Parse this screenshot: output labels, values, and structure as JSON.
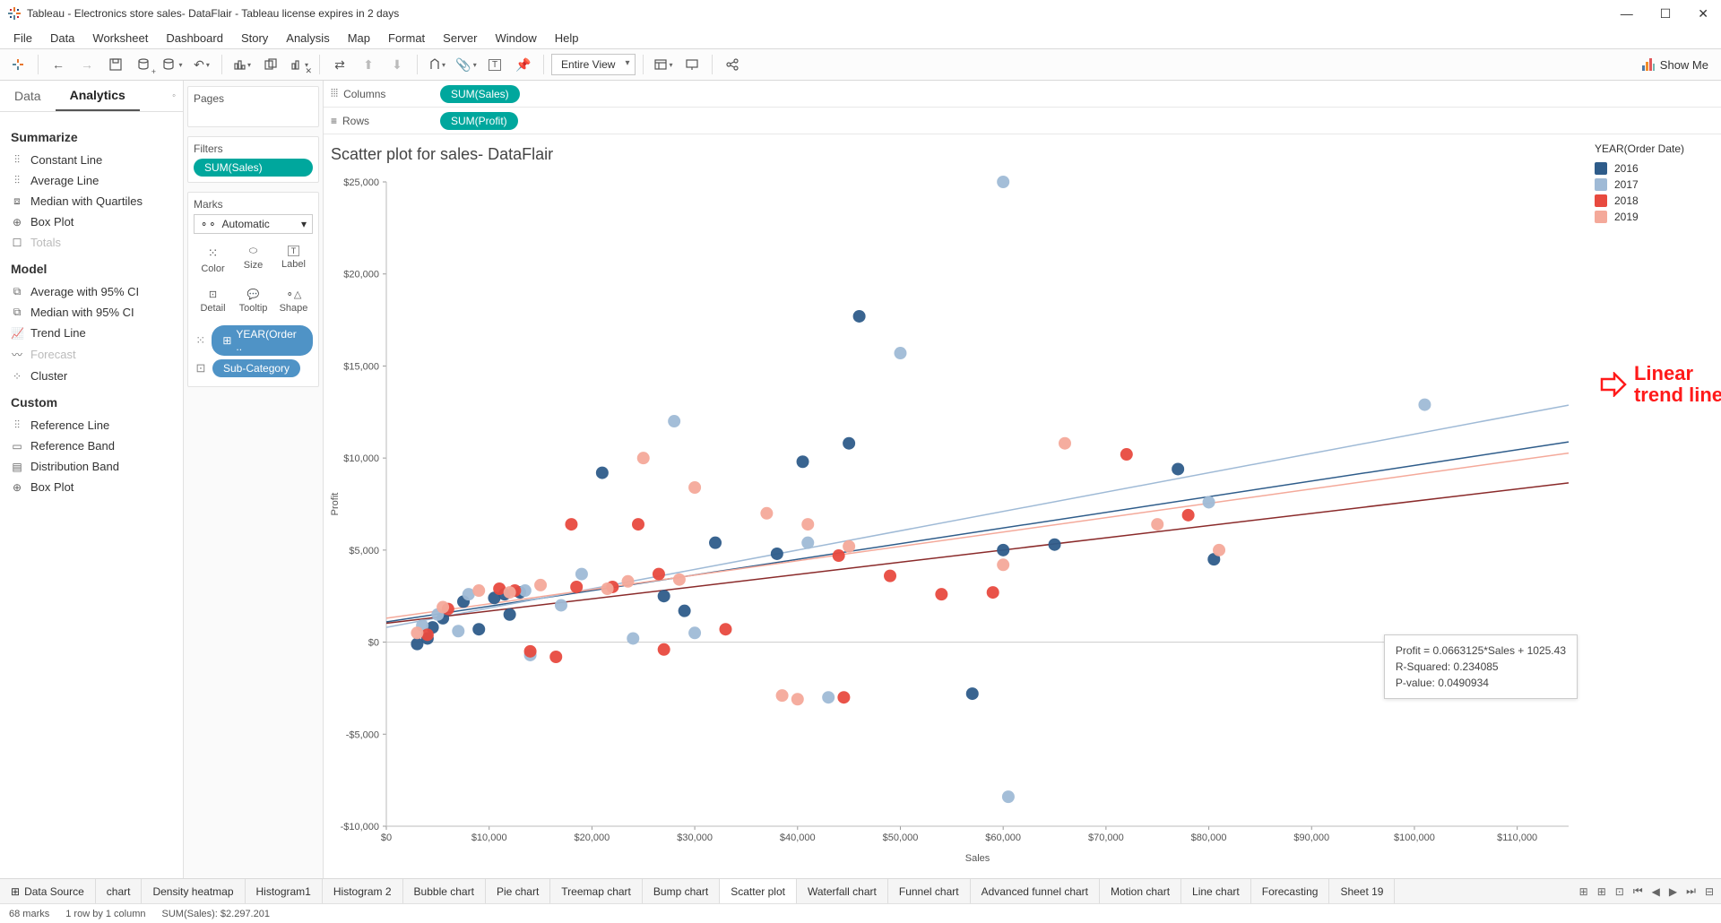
{
  "window": {
    "title": "Tableau - Electronics store sales- DataFlair - Tableau license expires in 2 days"
  },
  "menu": [
    "File",
    "Data",
    "Worksheet",
    "Dashboard",
    "Story",
    "Analysis",
    "Map",
    "Format",
    "Server",
    "Window",
    "Help"
  ],
  "toolbar": {
    "fit": "Entire View",
    "showme": "Show Me"
  },
  "sidepane": {
    "tabs": {
      "data": "Data",
      "analytics": "Analytics"
    },
    "summarize": {
      "head": "Summarize",
      "items": [
        "Constant Line",
        "Average Line",
        "Median with Quartiles",
        "Box Plot",
        "Totals"
      ]
    },
    "model": {
      "head": "Model",
      "items": [
        "Average with 95% CI",
        "Median with 95% CI",
        "Trend Line",
        "Forecast",
        "Cluster"
      ]
    },
    "custom": {
      "head": "Custom",
      "items": [
        "Reference Line",
        "Reference Band",
        "Distribution Band",
        "Box Plot"
      ]
    }
  },
  "shelves": {
    "pages": "Pages",
    "filters": "Filters",
    "filter_pill": "SUM(Sales)",
    "marks": "Marks",
    "marks_type": "Automatic",
    "mark_cells": [
      "Color",
      "Size",
      "Label",
      "Detail",
      "Tooltip",
      "Shape"
    ],
    "mark_pill1": "YEAR(Order ..",
    "mark_pill2": "Sub-Category",
    "columns_label": "Columns",
    "rows_label": "Rows",
    "col_pill": "SUM(Sales)",
    "row_pill": "SUM(Profit)"
  },
  "chart": {
    "title": "Scatter plot for sales- DataFlair",
    "xlabel": "Sales",
    "ylabel": "Profit",
    "legend_title": "YEAR(Order Date)"
  },
  "legend": [
    {
      "label": "2016",
      "color": "#2e5c8a"
    },
    {
      "label": "2017",
      "color": "#9fbad6"
    },
    {
      "label": "2018",
      "color": "#e84a3f"
    },
    {
      "label": "2019",
      "color": "#f4a99a"
    }
  ],
  "tooltip": {
    "l1": "Profit = 0.0663125*Sales + 1025.43",
    "l2": "R-Squared: 0.234085",
    "l3": "P-value: 0.0490934"
  },
  "annotation": "Linear\ntrend line",
  "sheets": {
    "ds": "Data Source",
    "tabs": [
      "chart",
      "Density heatmap",
      "Histogram1",
      "Histogram 2",
      "Bubble chart",
      "Pie chart",
      "Treemap chart",
      "Bump chart",
      "Scatter plot",
      "Waterfall chart",
      "Funnel chart",
      "Advanced funnel chart",
      "Motion chart",
      "Line chart",
      "Forecasting",
      "Sheet 19"
    ],
    "active": "Scatter plot"
  },
  "status": {
    "marks": "68 marks",
    "layout": "1 row by 1 column",
    "sum": "SUM(Sales): $2.297.201"
  },
  "chart_data": {
    "type": "scatter",
    "xlabel": "Sales",
    "ylabel": "Profit",
    "xlim": [
      0,
      115000
    ],
    "ylim": [
      -10000,
      25000
    ],
    "xticks": [
      0,
      10000,
      20000,
      30000,
      40000,
      50000,
      60000,
      70000,
      80000,
      90000,
      100000,
      110000
    ],
    "yticks": [
      -10000,
      -5000,
      0,
      5000,
      10000,
      15000,
      20000,
      25000
    ],
    "series": [
      {
        "name": "2016",
        "color": "#2e5c8a",
        "points": [
          [
            3000,
            -100
          ],
          [
            4000,
            200
          ],
          [
            4500,
            800
          ],
          [
            5500,
            1300
          ],
          [
            7500,
            2200
          ],
          [
            9000,
            700
          ],
          [
            10500,
            2400
          ],
          [
            11500,
            2600
          ],
          [
            12000,
            1500
          ],
          [
            13000,
            2700
          ],
          [
            21000,
            9200
          ],
          [
            27000,
            2500
          ],
          [
            29000,
            1700
          ],
          [
            32000,
            5400
          ],
          [
            38000,
            4800
          ],
          [
            40500,
            9800
          ],
          [
            45000,
            10800
          ],
          [
            46000,
            17700
          ],
          [
            57000,
            -2800
          ],
          [
            60000,
            5000
          ],
          [
            65000,
            5300
          ],
          [
            77000,
            9400
          ],
          [
            80500,
            4500
          ]
        ]
      },
      {
        "name": "2017",
        "color": "#9fbad6",
        "points": [
          [
            3500,
            900
          ],
          [
            5000,
            1500
          ],
          [
            7000,
            600
          ],
          [
            8000,
            2600
          ],
          [
            13500,
            2800
          ],
          [
            14000,
            -700
          ],
          [
            17000,
            2000
          ],
          [
            19000,
            3700
          ],
          [
            24000,
            200
          ],
          [
            28000,
            12000
          ],
          [
            30000,
            500
          ],
          [
            41000,
            5400
          ],
          [
            43000,
            -3000
          ],
          [
            50000,
            15700
          ],
          [
            60000,
            25000
          ],
          [
            60500,
            -8400
          ],
          [
            80000,
            7600
          ],
          [
            101000,
            12900
          ]
        ]
      },
      {
        "name": "2018",
        "color": "#e84a3f",
        "points": [
          [
            4000,
            400
          ],
          [
            6000,
            1800
          ],
          [
            11000,
            2900
          ],
          [
            12500,
            2800
          ],
          [
            14000,
            -500
          ],
          [
            16500,
            -800
          ],
          [
            18000,
            6400
          ],
          [
            18500,
            3000
          ],
          [
            22000,
            3000
          ],
          [
            24500,
            6400
          ],
          [
            26500,
            3700
          ],
          [
            27000,
            -400
          ],
          [
            33000,
            700
          ],
          [
            44000,
            4700
          ],
          [
            44500,
            -3000
          ],
          [
            49000,
            3600
          ],
          [
            54000,
            2600
          ],
          [
            59000,
            2700
          ],
          [
            72000,
            10200
          ],
          [
            78000,
            6900
          ]
        ]
      },
      {
        "name": "2019",
        "color": "#f4a99a",
        "points": [
          [
            3000,
            500
          ],
          [
            5500,
            1900
          ],
          [
            9000,
            2800
          ],
          [
            12000,
            2700
          ],
          [
            15000,
            3100
          ],
          [
            21500,
            2900
          ],
          [
            23500,
            3300
          ],
          [
            25000,
            10000
          ],
          [
            28500,
            3400
          ],
          [
            30000,
            8400
          ],
          [
            37000,
            7000
          ],
          [
            38500,
            -2900
          ],
          [
            40000,
            -3100
          ],
          [
            41000,
            6400
          ],
          [
            45000,
            5200
          ],
          [
            60000,
            4200
          ],
          [
            66000,
            10800
          ],
          [
            75000,
            6400
          ],
          [
            81000,
            5000
          ]
        ]
      }
    ],
    "trendlines": [
      {
        "name": "2016",
        "color": "#2e5c8a",
        "slope": 0.085,
        "intercept": 1100
      },
      {
        "name": "2017",
        "color": "#9fbad6",
        "slope": 0.105,
        "intercept": 800
      },
      {
        "name": "2018",
        "color": "#8a2a2a",
        "slope": 0.0663125,
        "intercept": 1025.43
      },
      {
        "name": "2019",
        "color": "#f4a99a",
        "slope": 0.078,
        "intercept": 1300
      }
    ]
  }
}
